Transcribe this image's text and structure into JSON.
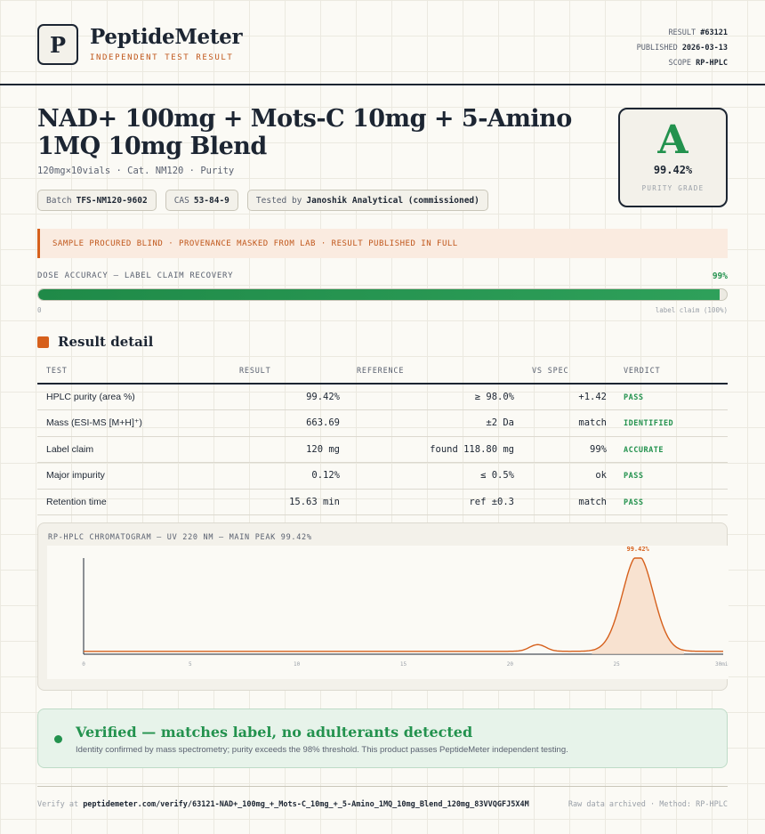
{
  "header": {
    "logo_letter": "P",
    "brand": "PeptideMeter",
    "brand_sub": "INDEPENDENT TEST RESULT",
    "meta": {
      "result_label": "RESULT",
      "result_value": "#63121",
      "published_label": "PUBLISHED",
      "published_value": "2026-03-13",
      "scope_label": "SCOPE",
      "scope_value": "RP-HPLC"
    }
  },
  "product": {
    "title": "NAD+ 100mg + Mots-C 10mg + 5-Amino 1MQ 10mg Blend",
    "subtitle": "120mg×10vials · Cat. NM120 · Purity",
    "chips": [
      {
        "label": "Batch",
        "value": "TFS-NM120-9602"
      },
      {
        "label": "CAS",
        "value": "53-84-9"
      },
      {
        "label": "Tested by",
        "value": "Janoshik Analytical (commissioned)"
      }
    ]
  },
  "grade": {
    "letter": "A",
    "value": "99.42%",
    "label": "PURITY GRADE"
  },
  "banner": "SAMPLE PROCURED BLIND · PROVENANCE MASKED FROM LAB · RESULT PUBLISHED IN FULL",
  "dose": {
    "label": "DOSE ACCURACY — LABEL CLAIM RECOVERY",
    "value_text": "99%",
    "percent": 99,
    "min_label": "0",
    "max_label": "label claim (100%)"
  },
  "results": {
    "title": "Result detail",
    "columns": {
      "test": "TEST",
      "result": "RESULT",
      "reference": "REFERENCE",
      "spec": "VS SPEC",
      "verdict": "VERDICT"
    },
    "rows": [
      {
        "test": "HPLC purity (area %)",
        "result": "99.42%",
        "reference": "≥ 98.0%",
        "spec": "+1.42",
        "verdict": "PASS"
      },
      {
        "test": "Mass (ESI-MS [M+H]⁺)",
        "result": "663.69",
        "reference": "±2 Da",
        "spec": "match",
        "verdict": "IDENTIFIED"
      },
      {
        "test": "Label claim",
        "result": "120 mg",
        "reference": "found 118.80 mg",
        "spec": "99%",
        "verdict": "ACCURATE"
      },
      {
        "test": "Major impurity",
        "result": "0.12%",
        "reference": "≤ 0.5%",
        "spec": "ok",
        "verdict": "PASS"
      },
      {
        "test": "Retention time",
        "result": "15.63 min",
        "reference": "ref ±0.3",
        "spec": "match",
        "verdict": "PASS"
      }
    ]
  },
  "chart_data": {
    "type": "line",
    "title": "RP-HPLC CHROMATOGRAM — UV 220 NM — MAIN PEAK 99.42%",
    "xlabel": "min",
    "ylabel": "",
    "xlim": [
      0,
      30
    ],
    "ylim": [
      0,
      1
    ],
    "x_ticks": [
      0,
      5,
      10,
      15,
      20,
      25,
      30
    ],
    "x_tick_labels": [
      "0",
      "5",
      "10",
      "15",
      "20",
      "25",
      "30"
    ],
    "x_unit_label": "min",
    "peaks": [
      {
        "center": 21.3,
        "height": 0.07,
        "width": 0.38
      },
      {
        "center": 26.0,
        "height": 1.0,
        "width": 0.72,
        "label": "99.42%",
        "main": true
      }
    ],
    "baseline": 0.03,
    "line_color": "#d6601c",
    "fill_color": "#f7d7c1"
  },
  "verified": {
    "title": "Verified — matches label, no adulterants detected",
    "description": "Identity confirmed by mass spectrometry; purity exceeds the 98% threshold. This product passes PeptideMeter independent testing."
  },
  "footer": {
    "verify_prefix": "Verify at",
    "verify_url": "peptidemeter.com/verify/63121-NAD+_100mg_+_Mots-C_10mg_+_5-Amino_1MQ_10mg_Blend_120mg_83VVQGFJ5X4M",
    "right": "Raw data archived · Method: RP-HPLC"
  },
  "colors": {
    "accent": "#d6601c",
    "pass": "#23924e",
    "ink": "#1c2532"
  }
}
